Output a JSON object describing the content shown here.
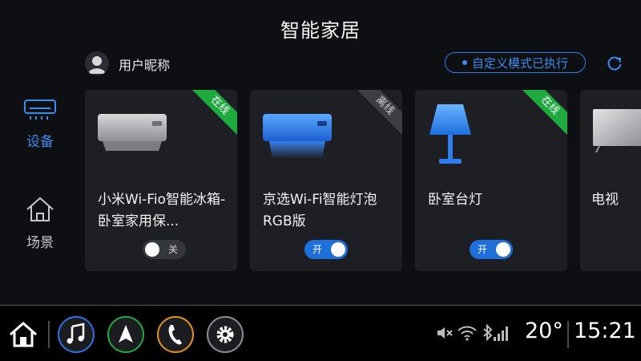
{
  "header": {
    "title": "智能家居"
  },
  "user": {
    "nickname": "用户昵称"
  },
  "mode": {
    "status": "自定义模式已执行"
  },
  "sidebar": {
    "items": [
      {
        "label": "设备",
        "icon": "air-conditioner-icon",
        "active": true,
        "color": "#3a8cf0"
      },
      {
        "label": "场景",
        "icon": "home-icon",
        "active": false
      }
    ]
  },
  "devices": [
    {
      "name": "小米Wi-Fio智能冰箱-卧室家用保...",
      "badge": "在线",
      "badge_color": "#1eaa3f",
      "switch_label": "关",
      "on": false,
      "icon": "air-conditioner-gray-icon"
    },
    {
      "name": "京选Wi-Fi智能灯泡 RGB版",
      "badge": "离线",
      "badge_color": "#3c3e44",
      "switch_label": "开",
      "on": true,
      "icon": "air-conditioner-blue-icon"
    },
    {
      "name": "卧室台灯",
      "badge": "在线",
      "badge_color": "#1eaa3f",
      "switch_label": "开",
      "on": true,
      "icon": "desk-lamp-icon"
    },
    {
      "name": "电视",
      "icon": "tv-icon"
    }
  ],
  "dock": {
    "items": [
      "home-icon",
      "music-icon",
      "navigation-icon",
      "phone-icon",
      "settings-icon"
    ],
    "colors": {
      "music": "#2f6fe0",
      "navigation": "#1eaa3f",
      "phone": "#e0901e",
      "settings": "#8a8c92"
    }
  },
  "status": {
    "icons": [
      "mute-icon",
      "wifi-icon",
      "bluetooth-icon",
      "signal-icon"
    ],
    "temperature": "20°",
    "time": "15:21"
  }
}
